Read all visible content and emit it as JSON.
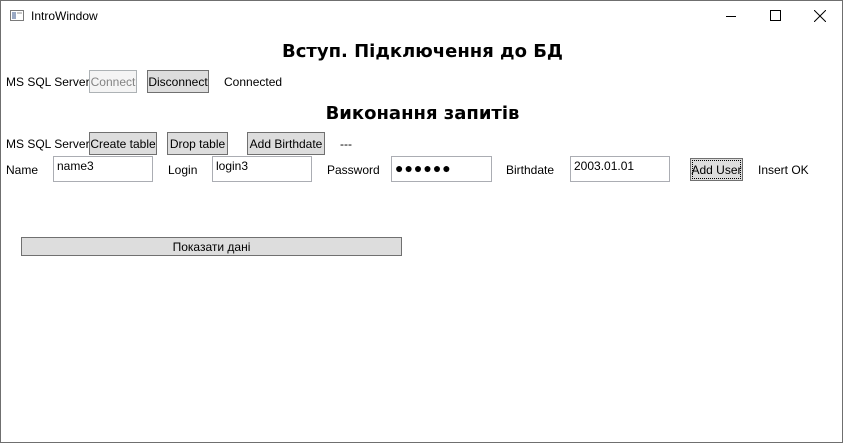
{
  "window": {
    "title": "IntroWindow",
    "app_icon": "window-icon"
  },
  "connection": {
    "heading": "Вступ. Підключення до БД",
    "server_label": "MS SQL Server",
    "connect_label": "Connect",
    "disconnect_label": "Disconnect",
    "status": "Connected"
  },
  "queries": {
    "heading": "Виконання запитів",
    "server_label": "MS SQL Server",
    "create_table_label": "Create table",
    "drop_table_label": "Drop table",
    "add_birthdate_label": "Add Birthdate",
    "status": "---"
  },
  "user_form": {
    "name_label": "Name",
    "name_value": "name3",
    "login_label": "Login",
    "login_value": "login3",
    "password_label": "Password",
    "password_value": "●●●●●●",
    "birthdate_label": "Birthdate",
    "birthdate_value": "2003.01.01",
    "add_user_label": "Add User",
    "status": "Insert OK"
  },
  "show_data_label": "Показати дані",
  "colors": {
    "button_bg": "#dddddd",
    "button_border": "#707070",
    "disabled_text": "#838383"
  }
}
